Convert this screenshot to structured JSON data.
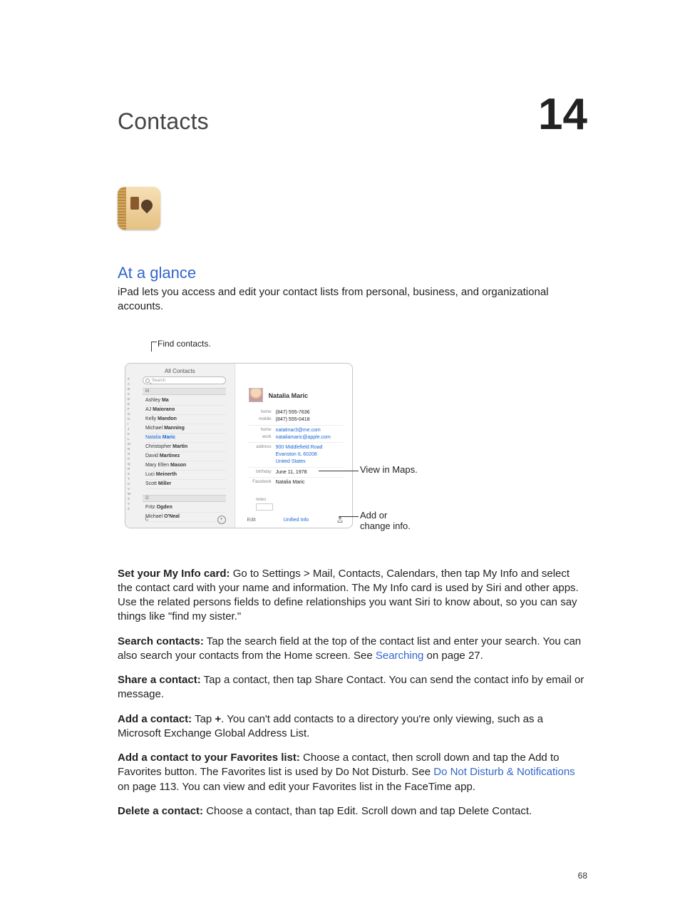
{
  "chapter": {
    "title": "Contacts",
    "number": "14"
  },
  "section_title": "At a glance",
  "intro": "iPad lets you access and edit your contact lists from personal, business, and organizational accounts.",
  "figure": {
    "top_callout": "Find contacts.",
    "right_callout_1": "View in Maps.",
    "right_callout_2a": "Add or",
    "right_callout_2b": "change info.",
    "left": {
      "title": "All Contacts",
      "search_placeholder": "Search",
      "index": "#\nA\nB\nC\nD\nE\nF\nG\nH\nI\nJ\nK\nL\nM\nN\nO\nP\nQ\nR\nS\nT\nU\nV\nW\nX\nY\nZ",
      "section_m": "M",
      "section_o": "O",
      "contacts_m": [
        {
          "first": "Ashley",
          "last": "Ma"
        },
        {
          "first": "AJ",
          "last": "Maiorano"
        },
        {
          "first": "Kelly",
          "last": "Mandon"
        },
        {
          "first": "Michael",
          "last": "Manning"
        },
        {
          "first": "Natalia",
          "last": "Maric",
          "selected": true
        },
        {
          "first": "Christopher",
          "last": "Martin"
        },
        {
          "first": "David",
          "last": "Martinez"
        },
        {
          "first": "Mary Ellen",
          "last": "Mason"
        },
        {
          "first": "Luci",
          "last": "Meinerth"
        },
        {
          "first": "Scott",
          "last": "Miller"
        }
      ],
      "contacts_o": [
        {
          "first": "Fritz",
          "last": "Ogden"
        },
        {
          "first": "Michael",
          "last": "O'Neal"
        }
      ],
      "groups": "C",
      "add": "+"
    },
    "card": {
      "name": "Natalia Maric",
      "rows": [
        {
          "lbl": "home",
          "val": "(847) 555-7636"
        },
        {
          "lbl": "mobile",
          "val": "(847) 555-0418"
        },
        {
          "lbl": "home",
          "val": "natalmar3@me.com",
          "link": true,
          "sep": true
        },
        {
          "lbl": "work",
          "val": "nataliamaric@apple.com",
          "link": true
        },
        {
          "lbl": "address",
          "val": "900 Middlefield Road",
          "link": true,
          "sep": true
        },
        {
          "lbl": "",
          "val": "Evanston IL 60208",
          "link": true
        },
        {
          "lbl": "",
          "val": "United States",
          "link": true
        },
        {
          "lbl": "birthday",
          "val": "June 11, 1978",
          "sep": true
        },
        {
          "lbl": "Facebook",
          "val": "Natalia Maric",
          "sep": true
        }
      ],
      "notes_label": "notes",
      "edit": "Edit",
      "unified": "Unified Info"
    }
  },
  "paragraphs": {
    "p1_label": "Set your My Info card:",
    "p1_text": "  Go to Settings > Mail, Contacts, Calendars, then tap My Info and select the contact card with your name and information. The My Info card is used by Siri and other apps. Use the related persons fields to define relationships you want Siri to know about, so you can say things like \"find my sister.\"",
    "p2_label": "Search contacts:",
    "p2_text_a": "  Tap the search field at the top of the contact list and enter your search. You can also search your contacts from the Home screen. See ",
    "p2_link": "Searching",
    "p2_text_b": " on page 27.",
    "p3_label": "Share a contact:",
    "p3_text": "  Tap a contact, then tap Share Contact. You can send the contact info by email or message.",
    "p4_label": "Add a contact:",
    "p4_text_a": "  Tap ",
    "p4_plus": "+",
    "p4_text_b": ". You can't add contacts to a directory you're only viewing, such as a Microsoft Exchange Global Address List.",
    "p5_label": "Add a contact to your Favorites list:",
    "p5_text_a": "  Choose a contact, then scroll down and tap the Add to Favorites button. The Favorites list is used by Do Not Disturb. See ",
    "p5_link": "Do Not Disturb & Notifications",
    "p5_text_b": " on page 113. You can view and edit your Favorites list in the FaceTime app.",
    "p6_label": "Delete a contact:",
    "p6_text": "  Choose a contact, than tap Edit. Scroll down and tap Delete Contact."
  },
  "page_number": "68"
}
